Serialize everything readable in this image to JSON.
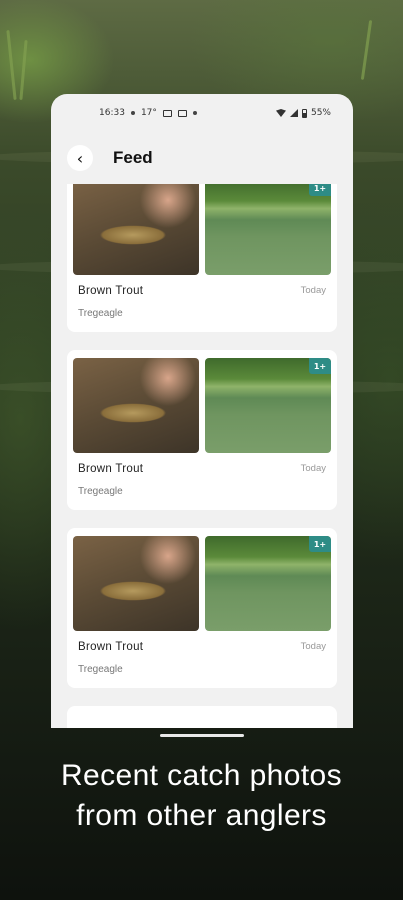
{
  "status_bar": {
    "time": "16:33",
    "temperature": "17°",
    "battery": "55%"
  },
  "header": {
    "title": "Feed",
    "back_icon": "chevron-left-icon"
  },
  "feed": {
    "cards": [
      {
        "species": "Brown Trout",
        "date": "Today",
        "location": "Tregeagle",
        "photo_count": "1+"
      },
      {
        "species": "Brown Trout",
        "date": "Today",
        "location": "Tregeagle",
        "photo_count": "1+"
      },
      {
        "species": "Brown Trout",
        "date": "Today",
        "location": "Tregeagle",
        "photo_count": "1+"
      }
    ]
  },
  "caption": {
    "line1": "Recent catch photos",
    "line2": "from other anglers"
  },
  "colors": {
    "badge": "#2e8c86",
    "screen_bg": "#f1f1f1"
  }
}
